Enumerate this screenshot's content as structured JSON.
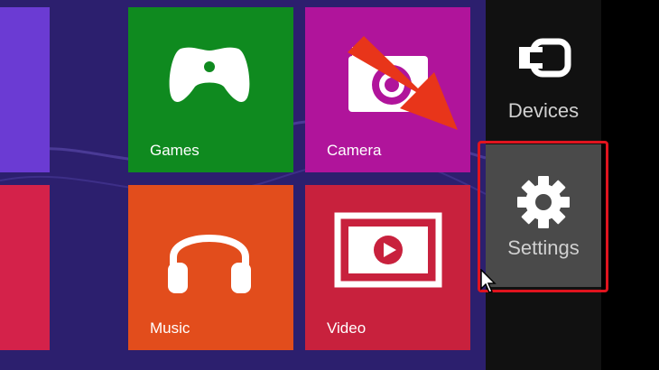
{
  "tiles": {
    "games": {
      "label": "Games",
      "color": "#0f8a1f"
    },
    "camera": {
      "label": "Camera",
      "color": "#b0149b"
    },
    "music": {
      "label": "Music",
      "color": "#e24d1c"
    },
    "video": {
      "label": "Video",
      "color": "#c8213d"
    },
    "left_top_color": "#6b3bd3",
    "left_bottom_color": "#d4224a"
  },
  "charms": {
    "devices": {
      "label": "Devices",
      "icon": "devices-icon"
    },
    "settings": {
      "label": "Settings",
      "icon": "gear-icon"
    }
  },
  "annotation": {
    "highlight_color": "#e0141e",
    "arrow_color": "#e8351a"
  }
}
